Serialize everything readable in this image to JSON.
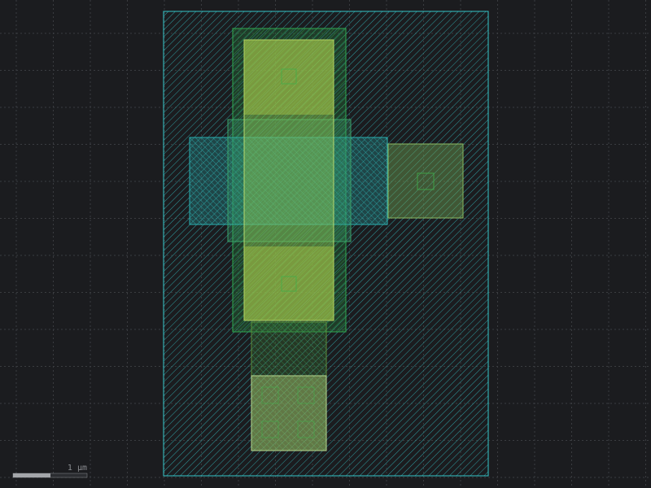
{
  "viewer": {
    "background_color": "#1b1c1f",
    "grid_color": "#3a3c40",
    "grid_style": "dotted"
  },
  "scale_bar": {
    "label": "1 µm"
  },
  "layers": [
    {
      "name": "nwell",
      "color": "#35c6c9",
      "fill": "diagonal-hatch"
    },
    {
      "name": "diffusion",
      "color": "#2fa84f",
      "fill": "diagonal-hatch"
    },
    {
      "name": "poly",
      "color": "#2aa8a8",
      "fill": "diagonal-hatch"
    },
    {
      "name": "metal1",
      "color": "#a8d060",
      "fill": "solid-translucent"
    },
    {
      "name": "contact",
      "color": "#3fae4a",
      "fill": "outline"
    }
  ]
}
